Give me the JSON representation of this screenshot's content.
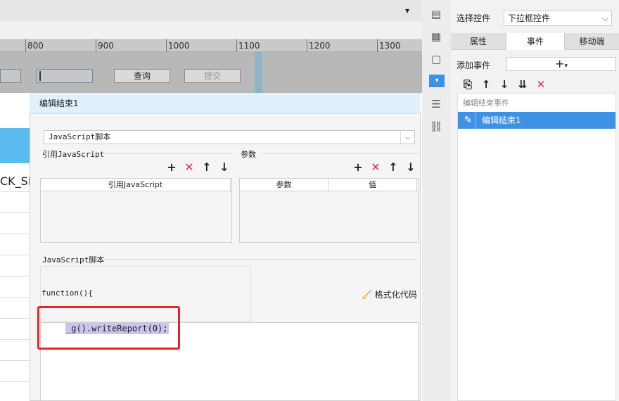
{
  "background": {
    "ruler_ticks": [
      "800",
      "900",
      "1000",
      "1100",
      "1200",
      "1300"
    ],
    "query_button": "查询",
    "submit_button": "提交",
    "left_column_text": "CK_SH"
  },
  "dialog": {
    "title": "编辑结束1",
    "script_type": "JavaScript脚本",
    "ref_js_section": "引用JavaScript",
    "params_section": "参数",
    "ref_js_column": "引用JavaScript",
    "param_column": "参数",
    "value_column": "值",
    "script_section": "JavaScript脚本",
    "function_header": "function(){",
    "code_line": "_g().writeReport(0);",
    "format_button": "格式化代码"
  },
  "right_panel": {
    "select_control_label": "选择控件",
    "select_control_value": "下拉框控件",
    "tabs": [
      "属性",
      "事件",
      "移动端"
    ],
    "active_tab": "事件",
    "add_event_label": "添加事件",
    "event_list_header": "编辑结束事件",
    "event_item": "编辑结束1"
  },
  "colors": {
    "accent": "#3d92e6",
    "highlight": "#e8232a",
    "selection": "#c9c6ee"
  }
}
